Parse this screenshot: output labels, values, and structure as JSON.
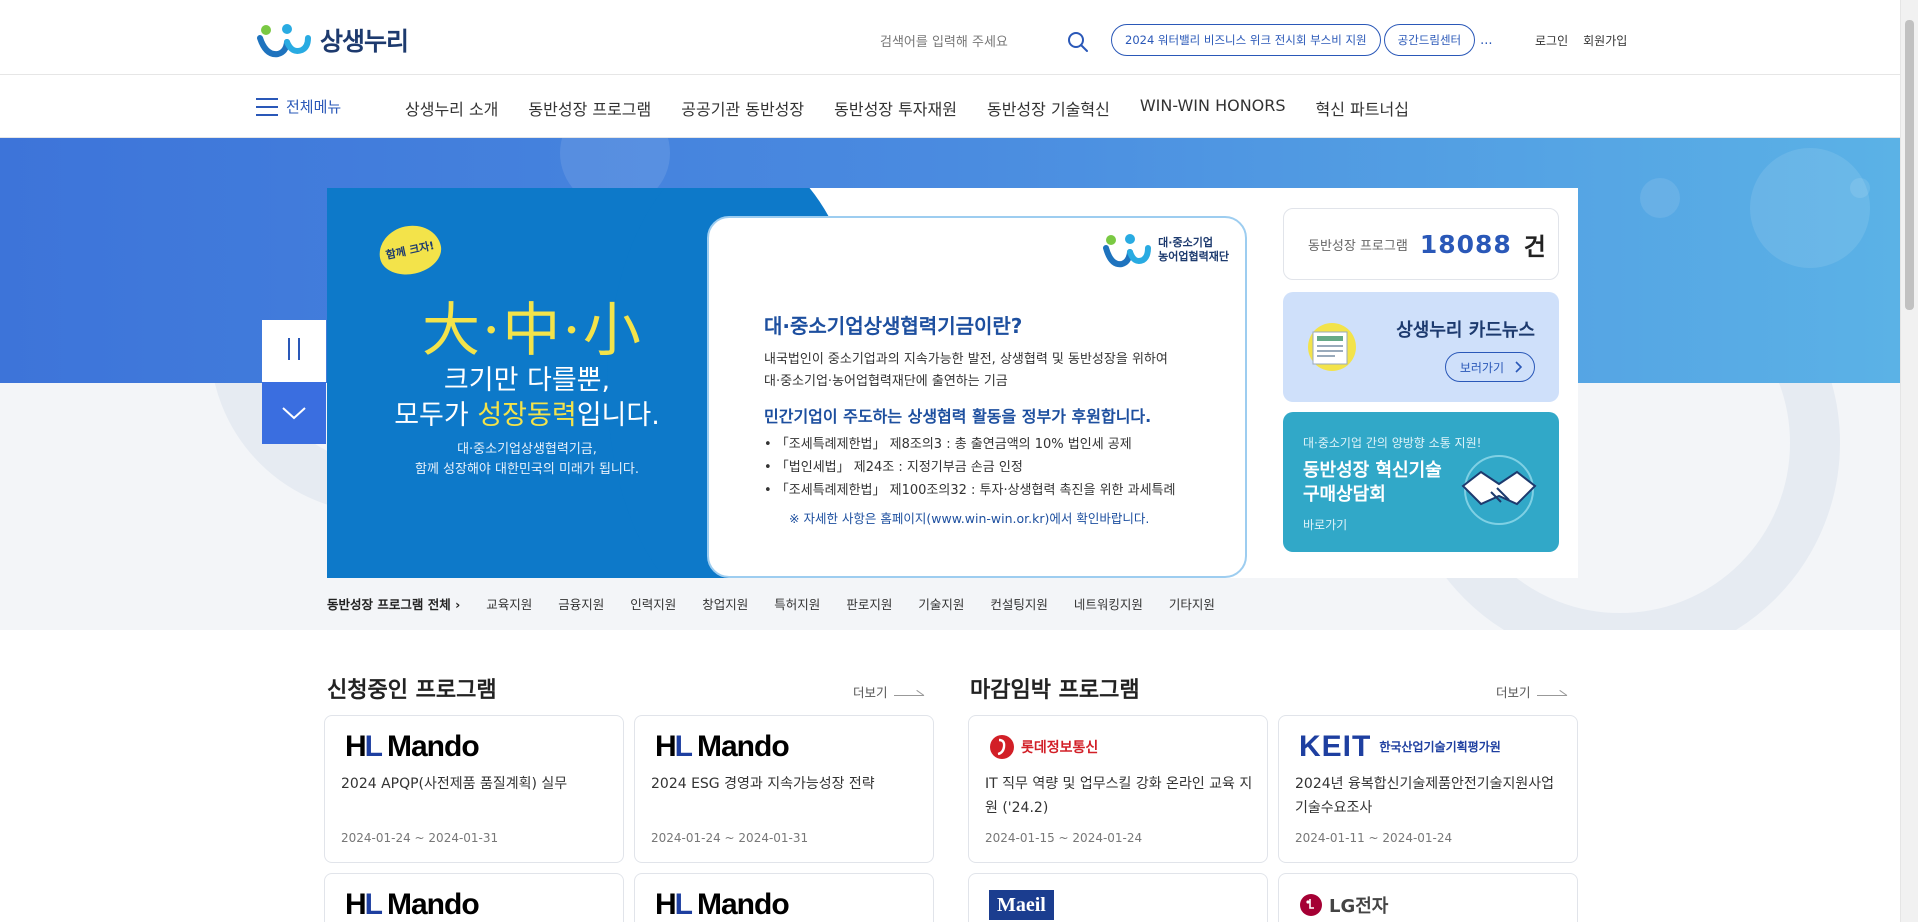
{
  "header": {
    "logo_text": "상생누리",
    "search_placeholder": "검색어를 입력해 주세요",
    "chips": [
      "2024 워터밸리 비즈니스 위크 전시회 부스비 지원",
      "공간드림센터"
    ],
    "chips_more": "...",
    "login": "로그인",
    "signup": "회원가입"
  },
  "nav": {
    "all_menu": "전체메뉴",
    "items": [
      "상생누리 소개",
      "동반성장 프로그램",
      "공공기관 동반성장",
      "동반성장 투자재원",
      "동반성장 기술혁신",
      "WIN-WIN HONORS",
      "혁신 파트너십"
    ]
  },
  "banner": {
    "bubble": "함께 크자!",
    "big": "大·中·小",
    "line1": "크기만 다를뿐,",
    "line2_pre": "모두가 ",
    "line2_hl": "성장동력",
    "line2_post": "입니다.",
    "small1": "대·중소기업상생협력기금,",
    "small2": "함께 성장해야 대한민국의 미래가 됩니다.",
    "org_line1": "대·중소기업",
    "org_line2": "농어업협력재단",
    "h1": "대·중소기업상생협력기금이란?",
    "p1": "내국법인이 중소기업과의 지속가능한 발전, 상생협력 및 동반성장을 위하여",
    "p2": "대·중소기업·농어업협력재단에 출연하는 기금",
    "h2": "민간기업이 주도하는 상생협력 활동을 정부가 후원합니다.",
    "bullets": [
      "• 「조세특례제한법」 제8조의3 : 총 출연금액의 10% 법인세 공제",
      "• 「법인세법」 제24조 : 지정기부금 손금 인정",
      "• 「조세특례제한법」 제100조의32 : 투자·상생협력 촉진을 위한 과세특례"
    ],
    "note": "※ 자세한 사항은 홈페이지(www.win-win.or.kr)에서 확인바랍니다."
  },
  "side": {
    "count_label": "동반성장 프로그램",
    "count_value": "18088",
    "count_unit": "건",
    "news_title": "상생누리 카드뉴스",
    "news_button": "보러가기",
    "tech_sub": "대·중소기업 간의 양방향 소통 지원!",
    "tech_title1": "동반성장 혁신기술",
    "tech_title2": "구매상담회",
    "tech_link": "바로가기"
  },
  "categories": {
    "all": "동반성장 프로그램 전체",
    "items": [
      "교육지원",
      "금융지원",
      "인력지원",
      "창업지원",
      "특허지원",
      "판로지원",
      "기술지원",
      "컨설팅지원",
      "네트워킹지원",
      "기타지원"
    ]
  },
  "ongoing": {
    "title": "신청중인 프로그램",
    "more": "더보기",
    "cards": [
      {
        "logo": "HL Mando",
        "title": "2024 APQP(사전제품 품질계획) 실무",
        "date": "2024-01-24 ~ 2024-01-31"
      },
      {
        "logo": "HL Mando",
        "title": "2024 ESG 경영과 지속가능성장 전략",
        "date": "2024-01-24 ~ 2024-01-31"
      },
      {
        "logo": "HL Mando"
      },
      {
        "logo": "HL Mando"
      }
    ]
  },
  "closing": {
    "title": "마감임박 프로그램",
    "more": "더보기",
    "cards": [
      {
        "logo": "롯데정보통신",
        "title": "IT 직무 역량 및 업무스킬 강화 온라인 교육 지원 ('24.2)",
        "date": "2024-01-15 ~ 2024-01-24"
      },
      {
        "logo": "KEIT",
        "logo_sub": "한국산업기술기획평가원",
        "title": "2024년 융복합신기술제품안전기술지원사업 기술수요조사",
        "date": "2024-01-11 ~ 2024-01-24"
      },
      {
        "logo": "Maeil"
      },
      {
        "logo": "LG전자"
      }
    ]
  },
  "colors": {
    "brand_blue": "#2a58b8",
    "hero_blue": "#3d74d9",
    "banner_blue": "#0d79c9",
    "news_card": "#cfe0fa",
    "tech_card": "#31a8c8"
  }
}
